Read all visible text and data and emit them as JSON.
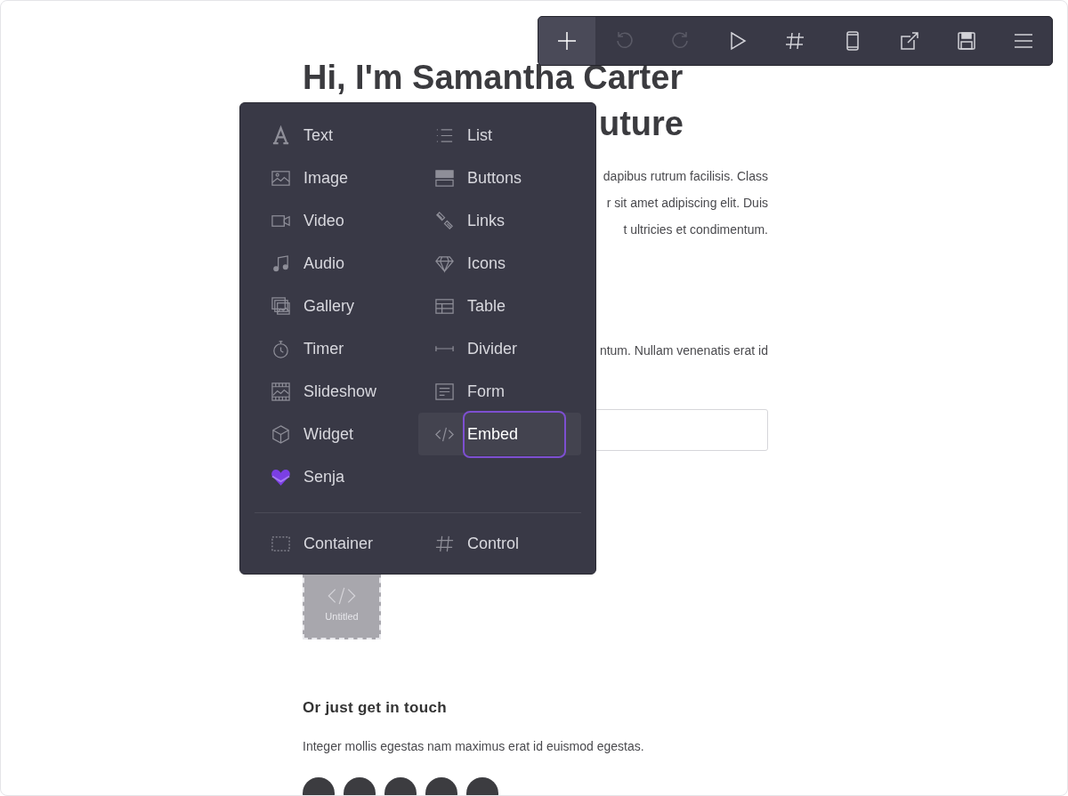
{
  "toolbar": {
    "buttons": [
      {
        "kind": "add",
        "selected": true,
        "disabled": false
      },
      {
        "kind": "undo",
        "selected": false,
        "disabled": true
      },
      {
        "kind": "redo",
        "selected": false,
        "disabled": true
      },
      {
        "kind": "preview",
        "selected": false,
        "disabled": false
      },
      {
        "kind": "grid",
        "selected": false,
        "disabled": false
      },
      {
        "kind": "mobile",
        "selected": false,
        "disabled": false
      },
      {
        "kind": "publish",
        "selected": false,
        "disabled": false
      },
      {
        "kind": "save",
        "selected": false,
        "disabled": false
      },
      {
        "kind": "menu",
        "selected": false,
        "disabled": false
      }
    ]
  },
  "page": {
    "heading": "Hi, I'm Samantha Carter",
    "heading_line_2": "uture",
    "paragraph_lines": [
      "dapibus rutrum facilisis. Class",
      "r sit amet adipiscing elit. Duis",
      "t ultricies et condimentum."
    ],
    "paragraph_2_line": "ntum. Nullam venenatis erat id",
    "embed_block": {
      "label": "Untitled"
    },
    "contact_heading": "Or just get in touch",
    "contact_text": "Integer mollis egestas nam maximus erat id euismod egestas."
  },
  "insert_menu": {
    "items": [
      {
        "kind": "text",
        "label": "Text",
        "selected": false
      },
      {
        "kind": "list",
        "label": "List",
        "selected": false
      },
      {
        "kind": "image",
        "label": "Image",
        "selected": false
      },
      {
        "kind": "buttons",
        "label": "Buttons",
        "selected": false
      },
      {
        "kind": "video",
        "label": "Video",
        "selected": false
      },
      {
        "kind": "links",
        "label": "Links",
        "selected": false
      },
      {
        "kind": "audio",
        "label": "Audio",
        "selected": false
      },
      {
        "kind": "icons",
        "label": "Icons",
        "selected": false
      },
      {
        "kind": "gallery",
        "label": "Gallery",
        "selected": false
      },
      {
        "kind": "table",
        "label": "Table",
        "selected": false
      },
      {
        "kind": "timer",
        "label": "Timer",
        "selected": false
      },
      {
        "kind": "divider",
        "label": "Divider",
        "selected": false
      },
      {
        "kind": "slideshow",
        "label": "Slideshow",
        "selected": false
      },
      {
        "kind": "form",
        "label": "Form",
        "selected": false
      },
      {
        "kind": "widget",
        "label": "Widget",
        "selected": false
      },
      {
        "kind": "embed",
        "label": "Embed",
        "selected": true
      },
      {
        "kind": "senja",
        "label": "Senja",
        "selected": false
      }
    ],
    "footer_items": [
      {
        "kind": "container",
        "label": "Container",
        "selected": false
      },
      {
        "kind": "control",
        "label": "Control",
        "selected": false
      }
    ]
  }
}
